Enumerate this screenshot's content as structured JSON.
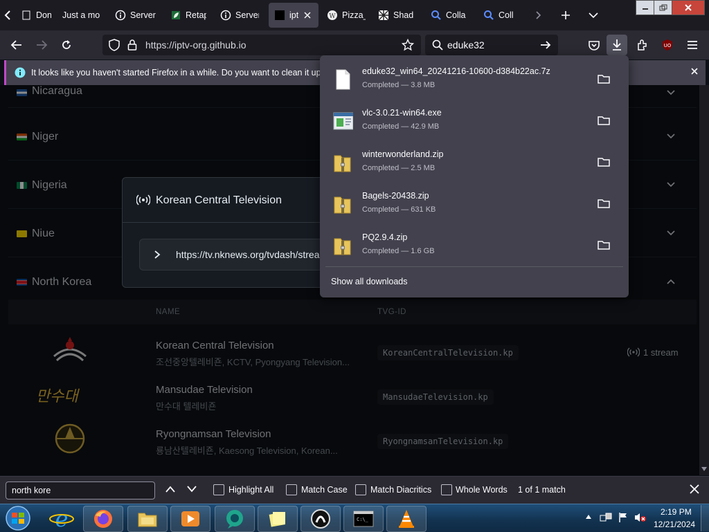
{
  "tabs": [
    {
      "label": "Dona",
      "icon": "page-icon"
    },
    {
      "label": "Just a mo",
      "icon": "none"
    },
    {
      "label": "Server",
      "icon": "info-circle-icon"
    },
    {
      "label": "Retap",
      "icon": "leaf-icon"
    },
    {
      "label": "Server",
      "icon": "info-circle-icon"
    },
    {
      "label": "ipt",
      "icon": "black-square-icon"
    },
    {
      "label": "Pizza_",
      "icon": "wikipedia-icon"
    },
    {
      "label": "Shad",
      "icon": "pattern-icon"
    },
    {
      "label": "Colla",
      "icon": "magnifier-icon"
    },
    {
      "label": "Coll",
      "icon": "magnifier-icon"
    }
  ],
  "urlbar": {
    "url": "https://iptv-org.github.io"
  },
  "searchbar": {
    "text": "eduke32"
  },
  "notification": {
    "text": "It looks like you haven't started Firefox in a while. Do you want to clean it up for"
  },
  "page": {
    "countries": [
      {
        "name": "Nicaragua",
        "flag_colors": [
          "#1e5aa8",
          "#ffffff"
        ]
      },
      {
        "name": "Niger",
        "flag_colors": [
          "#e05206",
          "#0db02b"
        ]
      },
      {
        "name": "Nigeria",
        "flag_colors": [
          "#008751",
          "#ffffff"
        ]
      },
      {
        "name": "Niue",
        "flag_colors": [
          "#fedd00",
          "#012169"
        ]
      },
      {
        "name": "North Korea",
        "flag_colors": [
          "#024fa2",
          "#ed1c27"
        ]
      }
    ],
    "table_headers": {
      "name": "NAME",
      "tvg_id": "TVG-ID"
    },
    "channels": [
      {
        "name": "Korean Central Television",
        "alt": "조선중앙텔레비죤, KCTV, Pyongyang Television...",
        "tvg_id": "KoreanCentralTelevision.kp",
        "streams": "1 stream"
      },
      {
        "name": "Mansudae Television",
        "alt": "만수대 텔레비죤",
        "tvg_id": "MansudaeTelevision.kp",
        "logo_text": "만수대"
      },
      {
        "name": "Ryongnamsan Television",
        "alt": "룡남산텔레비죤, Kaesong Television, Korean...",
        "tvg_id": "RyongnamsanTelevision.kp"
      }
    ]
  },
  "modal": {
    "title": "Korean Central Television",
    "stream_url": "https://tv.nknews.org/tvdash/strea"
  },
  "downloads": {
    "items": [
      {
        "file": "eduke32_win64_20241216-10600-d384b22ac.7z",
        "status": "Completed — 3.8 MB",
        "icon": "file-icon"
      },
      {
        "file": "vlc-3.0.21-win64.exe",
        "status": "Completed — 42.9 MB",
        "icon": "installer-icon"
      },
      {
        "file": "winterwonderland.zip",
        "status": "Completed — 2.5 MB",
        "icon": "zip-folder-icon"
      },
      {
        "file": "Bagels-20438.zip",
        "status": "Completed — 631 KB",
        "icon": "zip-folder-icon"
      },
      {
        "file": "PQ2.9.4.zip",
        "status": "Completed — 1.6 GB",
        "icon": "zip-folder-icon"
      }
    ],
    "show_all": "Show all downloads"
  },
  "findbar": {
    "query": "north kore",
    "highlight_all": "Highlight All",
    "match_case": "Match Case",
    "match_diacritics": "Match Diacritics",
    "whole_words": "Whole Words",
    "result": "1 of 1 match"
  },
  "taskbar": {
    "time": "2:19 PM",
    "date": "12/21/2024"
  },
  "colors": {
    "accent": "#c048c8",
    "toolbar": "#2b2a33",
    "panel": "#42414d",
    "page_bg": "#0d1117"
  }
}
